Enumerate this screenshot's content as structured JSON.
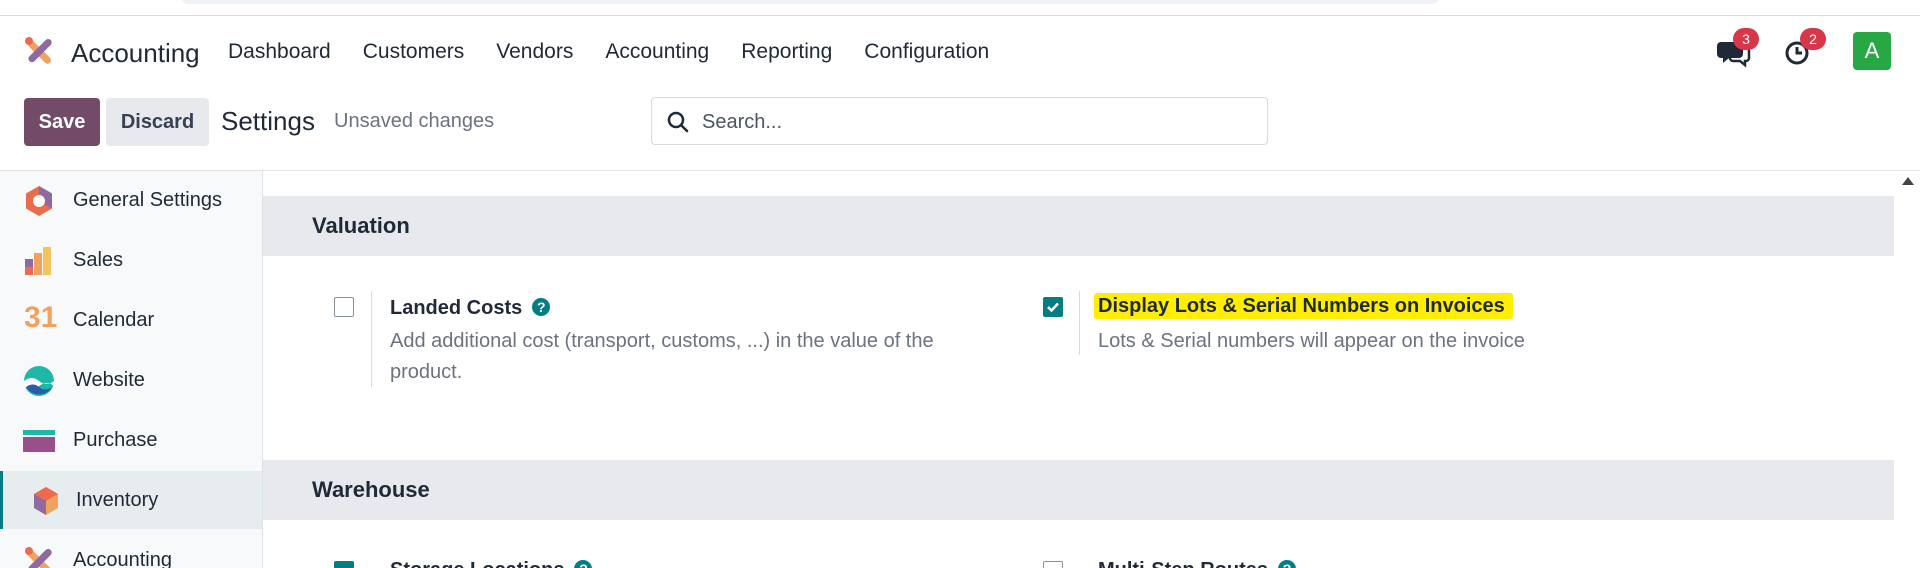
{
  "app": {
    "name": "Accounting",
    "menu": [
      "Dashboard",
      "Customers",
      "Vendors",
      "Accounting",
      "Reporting",
      "Configuration"
    ]
  },
  "systray": {
    "messages_count": "3",
    "activities_count": "2",
    "avatar_letter": "A",
    "avatar_color": "#28a745"
  },
  "control_panel": {
    "save_label": "Save",
    "discard_label": "Discard",
    "breadcrumb": "Settings",
    "status": "Unsaved changes",
    "search_placeholder": "Search..."
  },
  "sidebar": {
    "items": [
      {
        "label": "General Settings",
        "icon": "general-settings-icon"
      },
      {
        "label": "Sales",
        "icon": "sales-icon"
      },
      {
        "label": "Calendar",
        "icon": "calendar-icon",
        "icon_text": "31"
      },
      {
        "label": "Website",
        "icon": "website-icon"
      },
      {
        "label": "Purchase",
        "icon": "purchase-icon"
      },
      {
        "label": "Inventory",
        "icon": "inventory-icon",
        "active": true
      },
      {
        "label": "Accounting",
        "icon": "accounting-icon"
      }
    ]
  },
  "sections": [
    {
      "title": "Valuation",
      "settings": [
        {
          "title": "Landed Costs",
          "checked": false,
          "help": true,
          "description": "Add additional cost (transport, customs, ...) in the value of the product."
        },
        {
          "title": "Display Lots & Serial Numbers on Invoices",
          "checked": true,
          "help": false,
          "highlighted": true,
          "description": "Lots & Serial numbers will appear on the invoice"
        }
      ]
    },
    {
      "title": "Warehouse",
      "settings": [
        {
          "title": "Storage Locations",
          "checked": true,
          "help": true
        },
        {
          "title": "Multi-Step Routes",
          "checked": false,
          "help": true
        }
      ]
    }
  ],
  "colors": {
    "primary": "#714b67",
    "accent": "#017e84",
    "highlight": "#ffee00",
    "badge": "#d9364a"
  }
}
